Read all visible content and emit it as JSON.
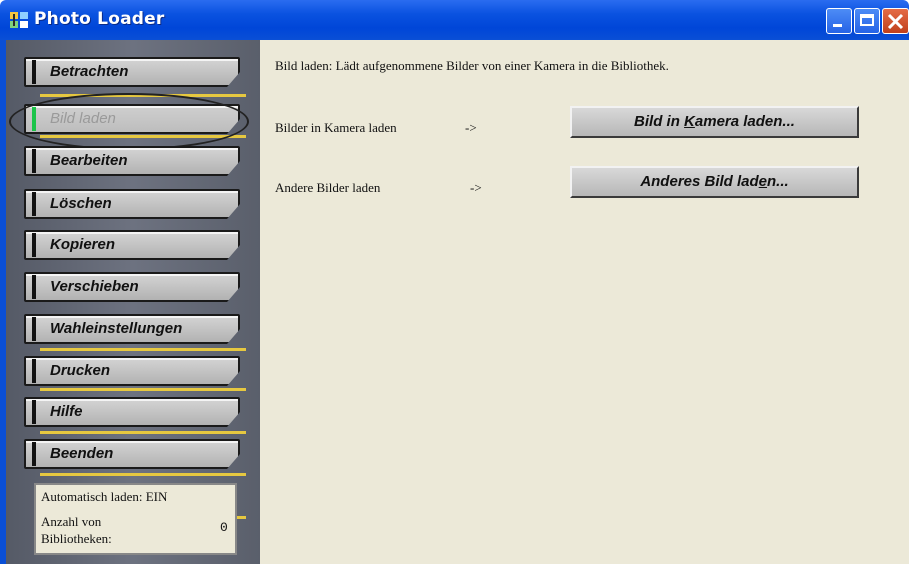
{
  "window": {
    "title": "Photo Loader",
    "app_icon": "photo-loader-icon",
    "controls": [
      "minimize-icon",
      "maximize-icon",
      "close-icon"
    ],
    "colors": {
      "titlebar": "#0a52e0",
      "sidebar": "#5f6470",
      "accent_separator": "#e6c840",
      "active_flag": "#1cc44a"
    }
  },
  "sidebar": {
    "items": [
      {
        "label": "Betrachten",
        "active": false
      },
      {
        "label": "Bild laden",
        "active": true
      },
      {
        "label": "Bearbeiten",
        "active": false
      },
      {
        "label": "Löschen",
        "active": false
      },
      {
        "label": "Kopieren",
        "active": false
      },
      {
        "label": "Verschieben",
        "active": false
      },
      {
        "label": "Wahleinstellungen",
        "active": false
      },
      {
        "label": "Drucken",
        "active": false
      },
      {
        "label": "Hilfe",
        "active": false
      },
      {
        "label": "Beenden",
        "active": false
      }
    ],
    "status": {
      "auto_load": "Automatisch laden: EIN",
      "library_count_label": "Anzahl von Bibliotheken:",
      "library_count_value": "0"
    }
  },
  "main": {
    "description": "Bild laden: Lädt aufgenommene Bilder von einer Kamera in die Bibliothek.",
    "rows": [
      {
        "label": "Bilder in Kamera laden",
        "arrow": "->",
        "button_pre": "Bild in ",
        "button_mnemonic": "K",
        "button_post": "amera laden..."
      },
      {
        "label": "Andere Bilder laden",
        "arrow": "->",
        "button_pre": "Anderes Bild lad",
        "button_mnemonic": "e",
        "button_post": "n..."
      }
    ]
  }
}
